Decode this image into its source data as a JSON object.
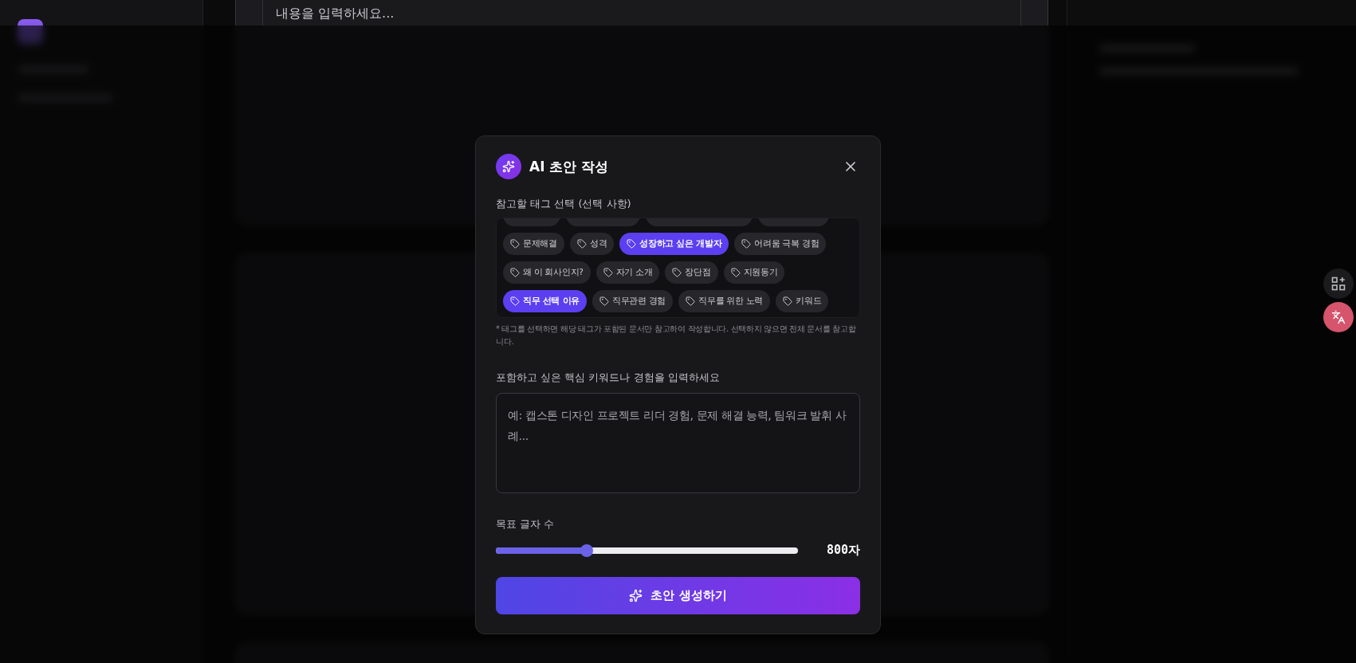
{
  "editor": {
    "placeholder": "내용을 입력하세요..."
  },
  "modal": {
    "title": "AI 초안 작성",
    "tag_section": {
      "label": "참고할 태그 선택 (선택 사항)",
      "tags": [
        {
          "label": "문제해결",
          "selected": false
        },
        {
          "label": "성격",
          "selected": false
        },
        {
          "label": "성장하고 싶은 개발자",
          "selected": true
        },
        {
          "label": "어려움 극복 경험",
          "selected": false
        },
        {
          "label": "왜 이 회사인지?",
          "selected": false
        },
        {
          "label": "자기 소개",
          "selected": false
        },
        {
          "label": "장단점",
          "selected": false
        },
        {
          "label": "지원동기",
          "selected": false
        },
        {
          "label": "직무 선택 이유",
          "selected": true
        },
        {
          "label": "직무관련 경험",
          "selected": false
        },
        {
          "label": "직무를 위한 노력",
          "selected": false
        },
        {
          "label": "키워드",
          "selected": false
        }
      ],
      "hint": "* 태그를 선택하면 해당 태그가 포함된 문서만 참고하여 작성합니다. 선택하지 않으면 전체 문서를 참고합니다."
    },
    "prompt": {
      "label": "포함하고 싶은 핵심 키워드나 경험을 입력하세요",
      "placeholder": "예: 캡스톤 디자인 프로젝트 리더 경험, 문제 해결 능력, 팀워크 발휘 사례..."
    },
    "length": {
      "label": "목표 글자 수",
      "level": 0.3,
      "reading": "800자"
    },
    "generate_button": "초안 생성하기"
  }
}
